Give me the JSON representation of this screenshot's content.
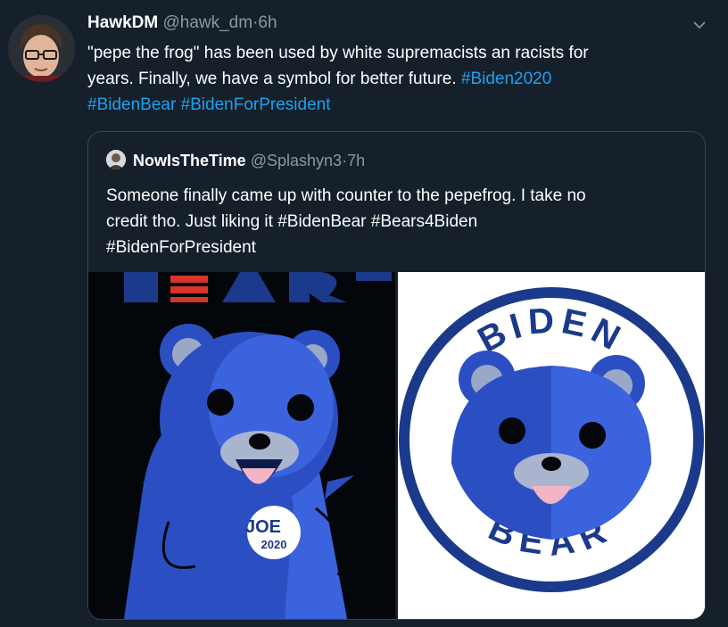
{
  "tweet": {
    "author_name": "HawkDM",
    "author_handle": "@hawk_dm",
    "separator": "·",
    "time": "6h",
    "text_line1": "\"pepe the frog\" has been used by white supremacists an racists for",
    "text_line2_plain": "years. Finally, we have a symbol for better future. ",
    "hashtags": [
      "#Biden2020",
      "#BidenBear",
      "#BidenForPresident"
    ],
    "menu_icon": "chevron-down-icon"
  },
  "quoted_tweet": {
    "author_name": "NowIsTheTime",
    "author_handle": "@Splashyn3",
    "separator": "·",
    "time": "7h",
    "text_line1": "Someone finally came up with counter to the pepefrog. I take no",
    "text_line2_plain": "credit tho. Just liking it ",
    "hashtags": [
      "#BidenBear",
      "#Bears4Biden",
      "#BidenForPresident"
    ],
    "images": [
      {
        "name": "biden-bear-poster",
        "caption_top": "BEAR",
        "badge_line1": "JOE",
        "badge_line2": "2020"
      },
      {
        "name": "biden-bear-logo",
        "ring_top": "BIDEN",
        "ring_bottom": "BEAR"
      }
    ]
  },
  "colors": {
    "background": "#15202b",
    "text": "#ffffff",
    "secondary": "#8899a6",
    "link": "#1da1f2",
    "border": "#38444d",
    "bear_blue": "#2e56c9",
    "navy": "#1b3a8c",
    "red": "#d8342c"
  }
}
